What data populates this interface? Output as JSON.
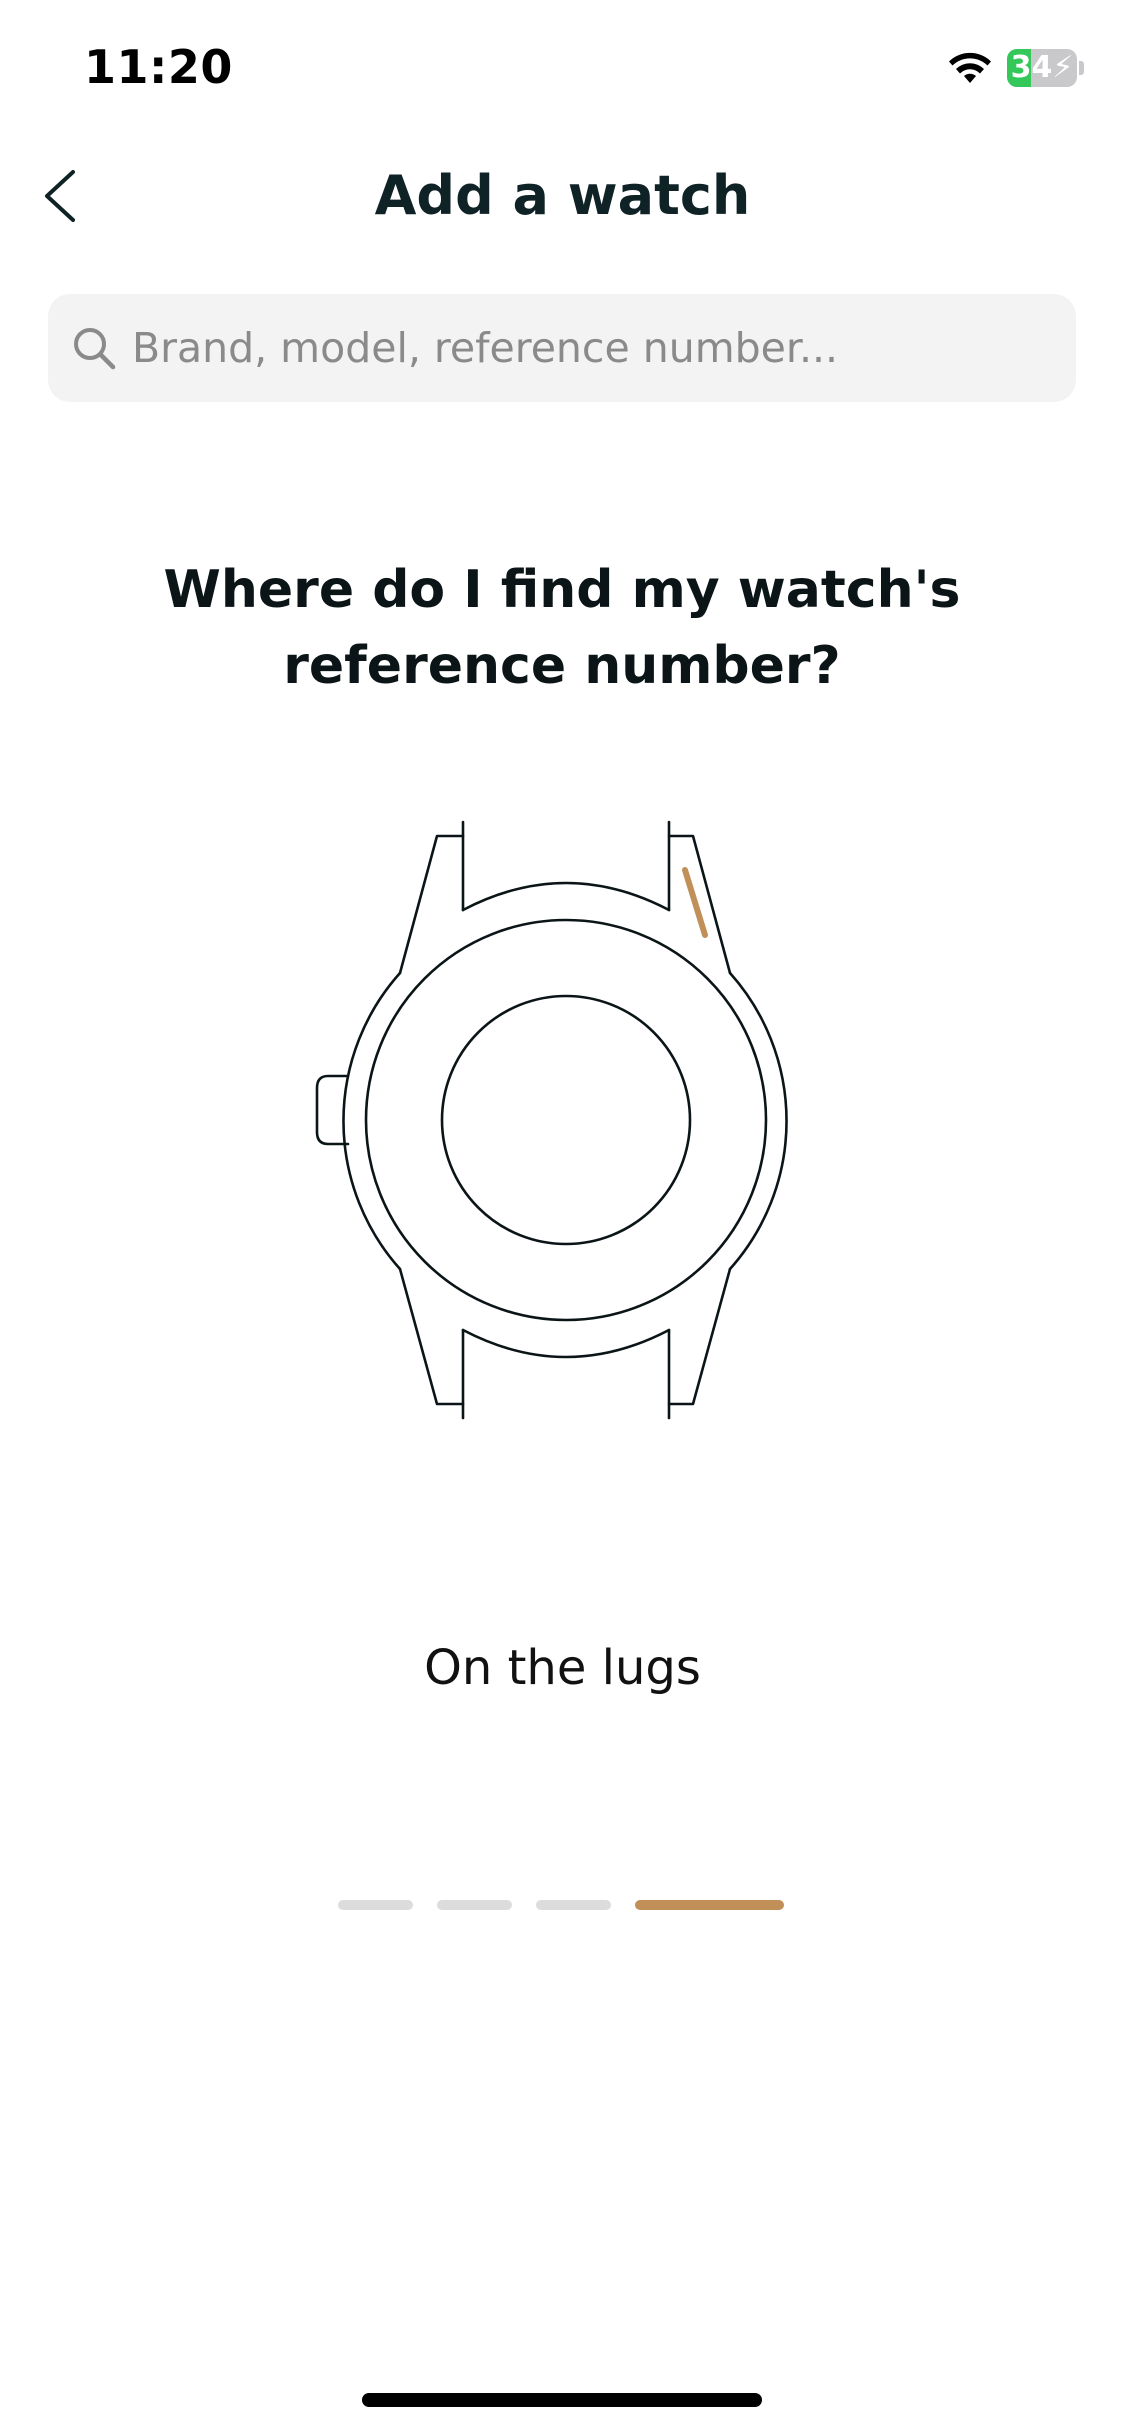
{
  "status_bar": {
    "time": "11:20",
    "battery_percent": "34",
    "battery_level": 0.34,
    "battery_color": "#34c759",
    "icons": [
      "wifi-icon",
      "battery-charging-icon"
    ]
  },
  "header": {
    "title": "Add a watch",
    "back_icon": "chevron-left-icon"
  },
  "search": {
    "placeholder": "Brand, model, reference number...",
    "value": "",
    "icon": "search-icon"
  },
  "help": {
    "heading_line1": "Where do I find my watch's",
    "heading_line2": "reference number?",
    "illustration_icon": "watch-outline-icon",
    "highlight_color": "#c09058",
    "caption": "On the lugs"
  },
  "pagination": {
    "total": 4,
    "active_index": 3,
    "active_color": "#c09058",
    "inactive_color": "#dcdcdc"
  }
}
